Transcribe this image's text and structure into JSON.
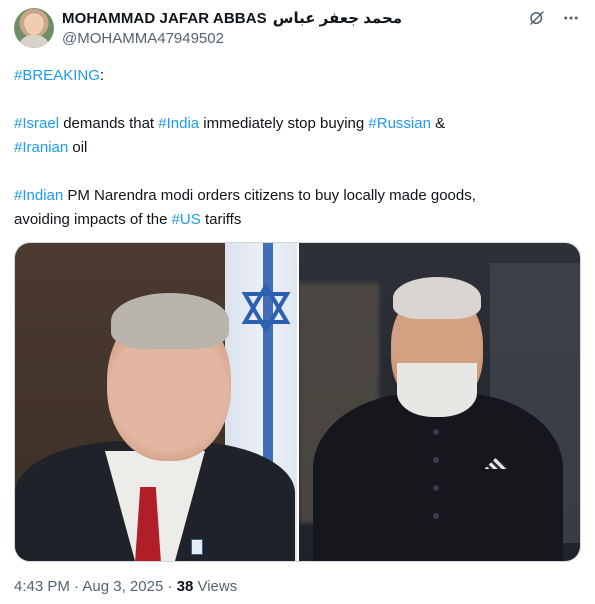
{
  "author": {
    "display_name": "MOHAMMAD JAFAR ABBAS",
    "display_name_arabic": "محمد جعفر عباس",
    "handle": "@MOHAMMA47949502",
    "avatar_icon": "avatar-photo"
  },
  "header_icons": [
    "grok-icon",
    "more-options-icon"
  ],
  "tweet": {
    "breaking": "#BREAKING",
    "breaking_colon": ":",
    "line2": {
      "h1": "#Israel",
      "t1": " demands that ",
      "h2": "#India",
      "t2": " immediately stop buying ",
      "h3": "#Russian",
      "t3": " &"
    },
    "line3": {
      "h1": "#Iranian",
      "t1": " oil"
    },
    "line4": {
      "h1": "#Indian",
      "t1": " PM Narendra modi orders citizens to buy locally made goods,"
    },
    "line5": {
      "t1": "avoiding impacts of the ",
      "h1": "#US",
      "t2": " tariffs"
    }
  },
  "media": {
    "photos": [
      "netanyahu-photo",
      "modi-photo"
    ]
  },
  "meta": {
    "time": "4:43 PM",
    "separator1": " · ",
    "date": "Aug 3, 2025",
    "separator2": " · ",
    "views_count": "38",
    "views_label": " Views"
  },
  "colors": {
    "hashtag": "#1d9bf0",
    "secondary_text": "#536471",
    "primary_text": "#0f1419"
  }
}
